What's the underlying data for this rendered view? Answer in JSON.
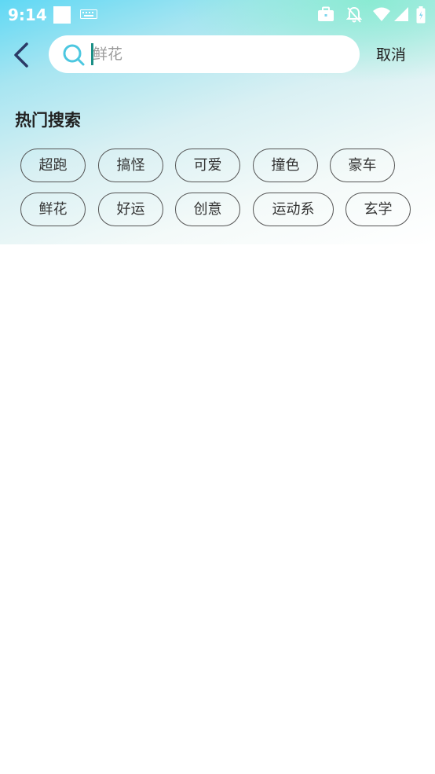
{
  "status_bar": {
    "time": "9:14",
    "icons": [
      "square-icon",
      "keyboard-icon",
      "briefcase-icon",
      "bell-off-icon",
      "wifi-icon",
      "signal-icon",
      "battery-icon"
    ]
  },
  "search": {
    "value": "",
    "placeholder": "鲜花",
    "cancel_label": "取消"
  },
  "hot": {
    "title": "热门搜索",
    "tags": [
      "超跑",
      "搞怪",
      "可爱",
      "撞色",
      "豪车",
      "鲜花",
      "好运",
      "创意",
      "运动系",
      "玄学"
    ]
  },
  "colors": {
    "accent": "#1a8f86",
    "search_icon": "#4cc7e0",
    "back_arrow": "#2b3a66"
  }
}
